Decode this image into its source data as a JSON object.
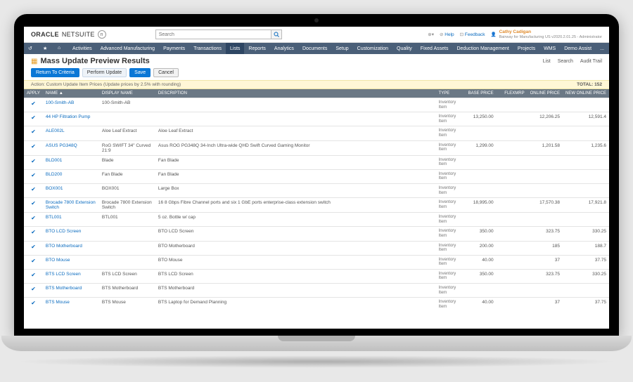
{
  "header": {
    "logo_brand": "ORACLE",
    "logo_product": "NETSUITE",
    "search_placeholder": "Search",
    "help_label": "Help",
    "feedback_label": "Feedback",
    "user_name": "Cathy Cadigan",
    "user_role": "Bairway for Manufacturing US v2020.2.01.25 - Administrator"
  },
  "nav": {
    "items": [
      "Activities",
      "Advanced Manufacturing",
      "Payments",
      "Transactions",
      "Lists",
      "Reports",
      "Analytics",
      "Documents",
      "Setup",
      "Customization",
      "Quality",
      "Fixed Assets",
      "Deduction Management",
      "Projects",
      "WMS",
      "Demo Assist",
      "..."
    ],
    "active_index": 4
  },
  "page": {
    "title": "Mass Update Preview Results",
    "right_links": [
      "List",
      "Search",
      "Audit Trail"
    ],
    "actions": {
      "return": "Return To Criteria",
      "perform": "Perform Update",
      "save": "Save",
      "cancel": "Cancel"
    },
    "info_bar_text": "Action: Custom Update Item Prices (Update prices by 2.5% with rounding)",
    "info_bar_total": "TOTAL: 152"
  },
  "table": {
    "headers": {
      "apply": "APPLY",
      "name": "NAME ▲",
      "display_name": "DISPLAY NAME",
      "description": "DESCRIPTION",
      "type": "TYPE",
      "base_price": "BASE PRICE",
      "flexmrp": "FLEXMRP",
      "online_price": "ONLINE PRICE",
      "new_online_price": "NEW ONLINE PRICE"
    },
    "rows": [
      {
        "name": "100-Smith-AB",
        "display": "100-Smith-AB",
        "desc": "",
        "type": "Inventory Item",
        "base": "",
        "flex": "",
        "online": "",
        "new": ""
      },
      {
        "name": "44 HP Filtration Pump",
        "display": "",
        "desc": "",
        "type": "Inventory Item",
        "base": "13,250.00",
        "flex": "",
        "online": "12,206.25",
        "new": "12,591.4"
      },
      {
        "name": "ALE002L",
        "display": "Aloe Leaf Extract",
        "desc": "Aloe Leaf Extract",
        "type": "Inventory Item",
        "base": "",
        "flex": "",
        "online": "",
        "new": ""
      },
      {
        "name": "ASUS PG348Q",
        "display": "RoG SWIFT 34\" Curved 21:9",
        "desc": "Asus ROG PG348Q 34-Inch Ultra-wide QHD Swift Curved Gaming Monitor",
        "type": "Inventory Item",
        "base": "1,299.00",
        "flex": "",
        "online": "1,201.58",
        "new": "1,235.6"
      },
      {
        "name": "BLD001",
        "display": "Blade",
        "desc": "Fan Blade",
        "type": "Inventory Item",
        "base": "",
        "flex": "",
        "online": "",
        "new": ""
      },
      {
        "name": "BLD200",
        "display": "Fan Blade",
        "desc": "Fan Blade",
        "type": "Inventory Item",
        "base": "",
        "flex": "",
        "online": "",
        "new": ""
      },
      {
        "name": "BOX001",
        "display": "BOX001",
        "desc": "Large Box",
        "type": "Inventory Item",
        "base": "",
        "flex": "",
        "online": "",
        "new": ""
      },
      {
        "name": "Brocade 7800 Extension Switch",
        "display": "Brocade 7800 Extension Switch",
        "desc": "16 8 Gbps Fibre Channel ports and six 1 GbE ports enterprise-class extension switch",
        "type": "Inventory Item",
        "base": "18,995.00",
        "flex": "",
        "online": "17,570.38",
        "new": "17,921.8"
      },
      {
        "name": "BTL001",
        "display": "BTL001",
        "desc": "5 oz. Bottle w/ cap",
        "type": "Inventory Item",
        "base": "",
        "flex": "",
        "online": "",
        "new": ""
      },
      {
        "name": "BTO LCD Screen",
        "display": "",
        "desc": "BTO LCD Screen",
        "type": "Inventory Item",
        "base": "350.00",
        "flex": "",
        "online": "323.75",
        "new": "330.25"
      },
      {
        "name": "BTO Motherboard",
        "display": "",
        "desc": "BTO Motherboard",
        "type": "Inventory Item",
        "base": "200.00",
        "flex": "",
        "online": "185",
        "new": "188.7"
      },
      {
        "name": "BTO Mouse",
        "display": "",
        "desc": "BTO Mouse",
        "type": "Inventory Item",
        "base": "40.00",
        "flex": "",
        "online": "37",
        "new": "37.75"
      },
      {
        "name": "BTS LCD Screen",
        "display": "BTS LCD Screen",
        "desc": "BTS LCD Screen",
        "type": "Inventory Item",
        "base": "350.00",
        "flex": "",
        "online": "323.75",
        "new": "330.25"
      },
      {
        "name": "BTS Motherboard",
        "display": "BTS Motherboard",
        "desc": "BTS Motherboard",
        "type": "Inventory Item",
        "base": "",
        "flex": "",
        "online": "",
        "new": ""
      },
      {
        "name": "BTS Mouse",
        "display": "BTS Mouse",
        "desc": "BTS Laptop for Demand Planning",
        "type": "Inventory Item",
        "base": "40.00",
        "flex": "",
        "online": "37",
        "new": "37.75"
      }
    ]
  }
}
